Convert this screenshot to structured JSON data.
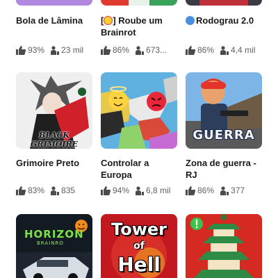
{
  "games": [
    {
      "title_lines": [
        "Bola de Lâmina",
        ""
      ],
      "rating": "93%",
      "players": "23 mil"
    },
    {
      "title_prefix": "[",
      "title_suffix": "] Roube um",
      "title_line2": "Brainrot",
      "rating": "86%",
      "players": "673..."
    },
    {
      "title_lines": [
        "Rodograu 2.0",
        ""
      ],
      "rating": "86%",
      "players": "4,4 mil"
    },
    {
      "title_lines": [
        "Grimoire Preto",
        ""
      ],
      "rating": "83%",
      "players": "835",
      "thumb_text": "BLACK GRIMOIRE"
    },
    {
      "title_lines": [
        "Controlar a",
        "Europa"
      ],
      "rating": "94%",
      "players": "6,8 mil"
    },
    {
      "title_lines": [
        "Zona de guerra -",
        "RJ"
      ],
      "rating": "86%",
      "players": "377",
      "thumb_text": "GUERRA"
    },
    {
      "thumb_text_1": "HORIZON",
      "thumb_text_2": "BRAINRO"
    },
    {
      "thumb_text_1": "Tower",
      "thumb_text_2": "of",
      "thumb_text_3": "Hell"
    },
    {}
  ],
  "colors": {
    "accent_red": "#e03a2f",
    "text_primary": "#1b1b1c",
    "text_secondary": "#606162",
    "badge_blue": "#4a90e2"
  },
  "icons": {
    "rating": "thumbs-up-icon",
    "players": "players-icon"
  }
}
